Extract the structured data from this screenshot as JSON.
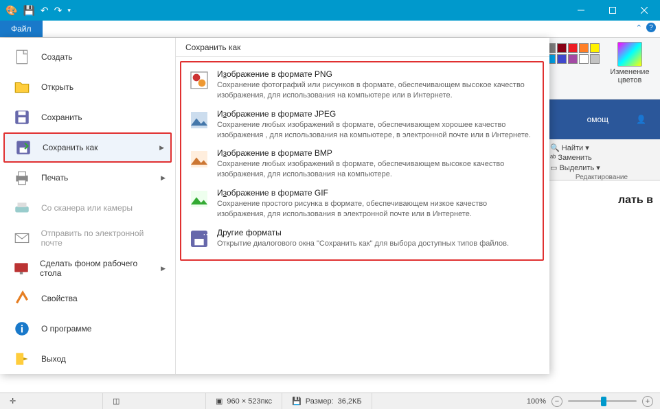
{
  "titlebar": {
    "app_icon": "paint"
  },
  "tabs": {
    "file": "Файл"
  },
  "ribbon_bg": {
    "editcolors_label": "Изменение цветов",
    "swatches_row1": [
      "#000000",
      "#7f7f7f",
      "#880015",
      "#ed1c24",
      "#ff7f27",
      "#fff200"
    ],
    "swatches_row2": [
      "#22b14c",
      "#00a2e8",
      "#3f48cc",
      "#a349a4",
      "#ffffff",
      "#c3c3c3"
    ]
  },
  "wordpeek": {
    "tab": "омощ",
    "find": "Найти",
    "replace": "Заменить",
    "select": "Выделить",
    "group": "Редактирование",
    "body": "лать в"
  },
  "filemenu": {
    "items": [
      {
        "icon": "new",
        "label": "Создать"
      },
      {
        "icon": "open",
        "label": "Открыть"
      },
      {
        "icon": "save",
        "label": "Сохранить"
      },
      {
        "icon": "saveas",
        "label": "Сохранить как",
        "arrow": true,
        "selected": true
      },
      {
        "icon": "print",
        "label": "Печать",
        "arrow": true
      },
      {
        "icon": "scanner",
        "label": "Со сканера или камеры",
        "disabled": true
      },
      {
        "icon": "email",
        "label": "Отправить по электронной почте",
        "disabled": true
      },
      {
        "icon": "wallpaper",
        "label": "Сделать фоном рабочего стола",
        "arrow": true
      },
      {
        "icon": "props",
        "label": "Свойства"
      },
      {
        "icon": "about",
        "label": "О программе"
      },
      {
        "icon": "exit",
        "label": "Выход"
      }
    ],
    "panel_title": "Сохранить как",
    "options": [
      {
        "icon": "png",
        "title": "Изображение в формате PNG",
        "udl": "з",
        "desc": "Сохранение фотографий или рисунков в формате, обеспечивающем высокое качество изображения, для использования на компьютере или в Интернете."
      },
      {
        "icon": "jpeg",
        "title": "Изображение в формате JPEG",
        "udl": "з",
        "desc": "Сохранение любых изображений в формате, обеспечивающем хорошее качество изображения , для использования на компьютере, в электронной почте или в Интернете."
      },
      {
        "icon": "bmp",
        "title": "Изображение в формате BMP",
        "udl": "з",
        "desc": "Сохранение любых изображений в формате, обеспечивающем высокое качество изображения, для использования на компьютере."
      },
      {
        "icon": "gif",
        "title": "Изображение в формате GIF",
        "udl": "з",
        "desc": "Сохранение простого рисунка в формате, обеспечивающем низкое качество изображения, для использования в электронной почте или в Интернете."
      },
      {
        "icon": "other",
        "title": "Другие форматы",
        "udl": "Д",
        "desc": "Открытие диалогового окна \"Сохранить как\" для выбора доступных типов файлов."
      }
    ]
  },
  "status": {
    "dims": "960 × 523пкс",
    "size_label": "Размер:",
    "size_val": "36,2КБ",
    "zoom": "100%"
  }
}
